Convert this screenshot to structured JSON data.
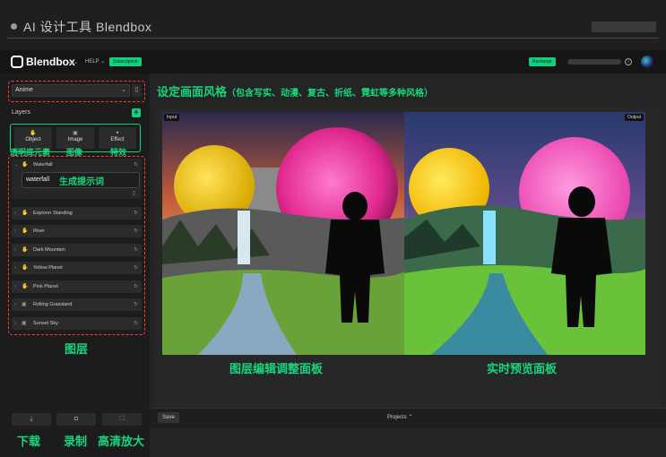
{
  "window": {
    "title": "AI 设计工具 Blendbox"
  },
  "header": {
    "logo_text": "Blendbox",
    "logo_sub": "alpha",
    "help_label": "HELP ⌄",
    "subscription_label": "Subscription",
    "recharge_label": "Recharge",
    "info_icon": "i"
  },
  "sidebar": {
    "style_value": "Anime",
    "layers_label": "Layers",
    "add_label": "+",
    "types": [
      {
        "label": "Object",
        "icon": "hand-icon"
      },
      {
        "label": "Image",
        "icon": "image-icon"
      },
      {
        "label": "Effect",
        "icon": "sparkle-icon"
      }
    ],
    "expanded_layer": "Waterfall",
    "prompt_value": "waterfall",
    "layers": [
      "Explorer Standing",
      "River",
      "Dark Mountain",
      "Yellow Planet",
      "Pink Planet",
      "Rolling Grassland",
      "Sunset Sky"
    ],
    "bottom_buttons": [
      "download-icon",
      "record-icon",
      "expand-icon"
    ]
  },
  "main": {
    "input_tag": "Input",
    "output_tag": "Output",
    "save_label": "Save",
    "projects_label": "Projects ⌃"
  },
  "annotations": {
    "style_note": "设定画面风格",
    "style_note_sub": "（包含写实、动漫、复古、折纸、霓虹等多种风格）",
    "object_note": "透明底元素",
    "image_note": "图像",
    "effect_note": "特效",
    "prompt_note": "生成提示词",
    "layers_note": "图层",
    "edit_panel_note": "图层编辑调整面板",
    "preview_note": "实时预览面板",
    "download_note": "下载",
    "record_note": "录制",
    "hd_note": "高清放大"
  },
  "colors": {
    "accent": "#10d27e",
    "annotation": "#18d67d",
    "highlight_dash": "#ff3b3b"
  }
}
